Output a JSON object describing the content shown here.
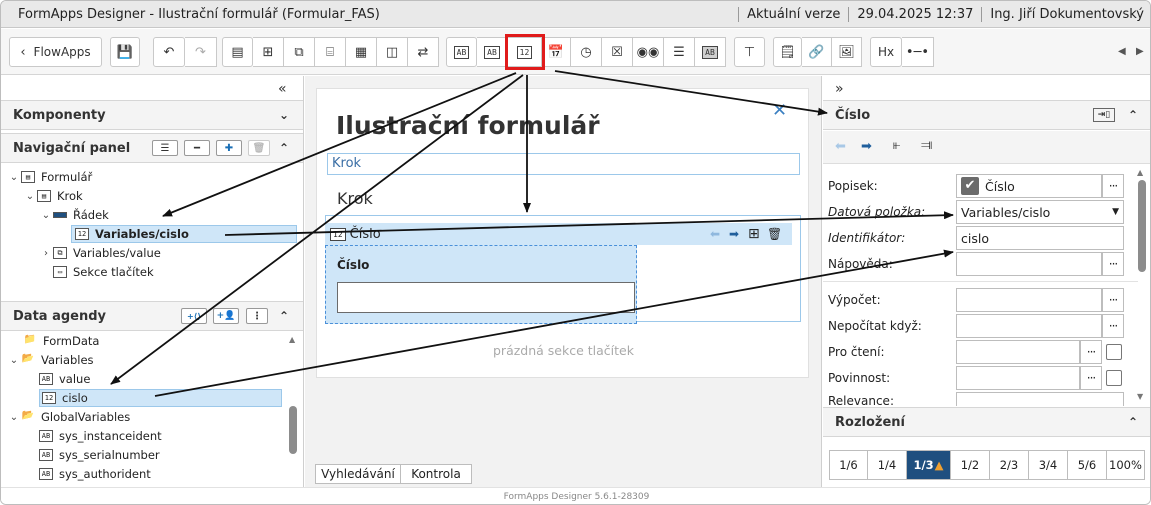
{
  "titlebar": {
    "app_title": "FormApps Designer - Ilustrační formulář (Formular_FAS)",
    "version": "Aktuální verze",
    "datetime": "29.04.2025 12:37",
    "user": "Ing. Jiří Dokumentovský"
  },
  "toolbar": {
    "back_label": "FlowApps",
    "icons": [
      "save-icon",
      "undo-icon",
      "redo-icon",
      "step-icon",
      "row-icon",
      "section-icon",
      "group-icon",
      "table-icon",
      "columns-icon",
      "repeat-icon",
      "text-field-icon",
      "text-area-icon",
      "number-field-icon",
      "date-field-icon",
      "time-field-icon",
      "checkbox-field-icon",
      "radio-icon",
      "select-icon",
      "readonly-text-icon",
      "stamp-icon",
      "note-icon",
      "link-icon",
      "image-icon",
      "heading-icon",
      "divider-icon"
    ],
    "box_ab": "AB",
    "box_num": "12",
    "heading_label": "Hx"
  },
  "left": {
    "komponenty": "Komponenty",
    "nav_title": "Navigační panel",
    "tree": [
      {
        "label": "Formulář",
        "icon": "form-icon"
      },
      {
        "label": "Krok",
        "icon": "step-icon"
      },
      {
        "label": "Řádek",
        "icon": "row-icon"
      },
      {
        "label": "Variables/cislo",
        "icon": "number-field-icon",
        "badge": "12"
      },
      {
        "label": "Variables/value",
        "icon": "group-icon"
      },
      {
        "label": "Sekce tlačítek",
        "icon": "button-section-icon"
      }
    ],
    "data_title": "Data agendy",
    "data_tree": [
      {
        "label": "FormData"
      },
      {
        "label": "Variables"
      },
      {
        "label": "value",
        "badge": "AB"
      },
      {
        "label": "cislo",
        "badge": "12"
      },
      {
        "label": "GlobalVariables"
      },
      {
        "label": "sys_instanceident",
        "badge": "AB"
      },
      {
        "label": "sys_serialnumber",
        "badge": "AB"
      },
      {
        "label": "sys_authorident",
        "badge": "AB"
      }
    ]
  },
  "center": {
    "form_title": "Ilustrační formulář",
    "step_tab": "Krok",
    "step_heading": "Krok",
    "field_label": "Číslo",
    "field_badge": "12",
    "inner_label": "Číslo",
    "empty_buttons": "prázdná sekce tlačítek",
    "tabs": [
      "Vyhledávání",
      "Kontrola"
    ]
  },
  "right": {
    "title": "Číslo",
    "fields": [
      {
        "label": "Popisek:",
        "value": "Číslo"
      },
      {
        "label": "Datová položka:",
        "value": "Variables/cislo"
      },
      {
        "label": "Identifikátor:",
        "value": "cislo"
      },
      {
        "label": "Nápověda:",
        "value": ""
      },
      {
        "label": "Výpočet:",
        "value": ""
      },
      {
        "label": "Nepočítat když:",
        "value": ""
      },
      {
        "label": "Pro čtení:",
        "value": ""
      },
      {
        "label": "Povinnost:",
        "value": ""
      },
      {
        "label": "Relevance:",
        "value": ""
      }
    ],
    "dots": "···",
    "layout_title": "Rozložení",
    "layout_options": [
      "1/6",
      "1/4",
      "1/3",
      "1/2",
      "2/3",
      "3/4",
      "5/6",
      "100%"
    ],
    "layout_selected": "1/3"
  },
  "statusbar": "FormApps Designer 5.6.1-28309",
  "colors": {
    "accent": "#1f4f7f",
    "highlight": "#e01b1b",
    "selection": "#cfe6f8"
  }
}
